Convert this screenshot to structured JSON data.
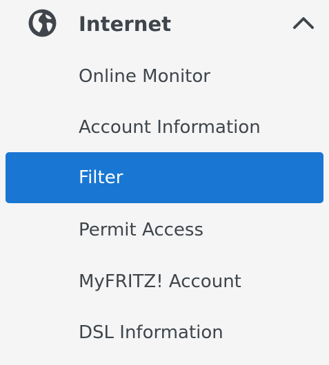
{
  "section": {
    "title": "Internet",
    "expanded": true,
    "icon": "globe-icon",
    "collapse_icon": "chevron-up-icon"
  },
  "items": [
    {
      "label": "Online Monitor",
      "active": false
    },
    {
      "label": "Account Information",
      "active": false
    },
    {
      "label": "Filter",
      "active": true
    },
    {
      "label": "Permit Access",
      "active": false
    },
    {
      "label": "MyFRITZ! Account",
      "active": false
    },
    {
      "label": "DSL Information",
      "active": false
    }
  ],
  "colors": {
    "active_background": "#1976d2",
    "active_text": "#ffffff",
    "text": "#3f454b",
    "background": "#f5f5f5"
  }
}
